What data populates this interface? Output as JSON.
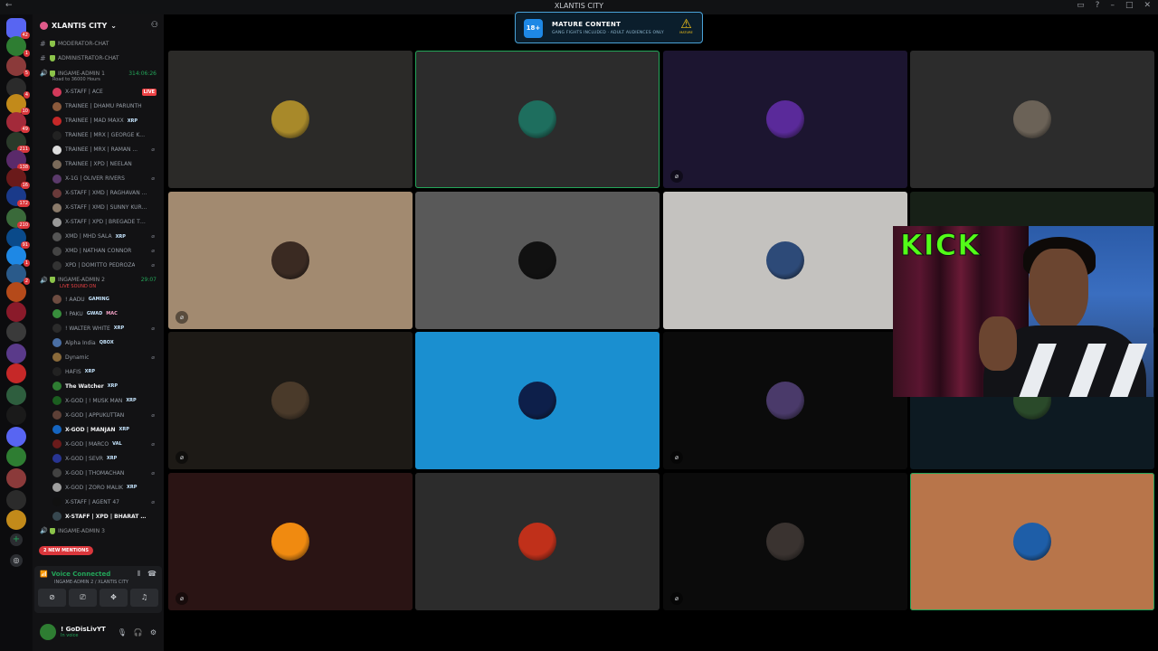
{
  "window": {
    "title": "XLANTIS CITY"
  },
  "server": {
    "name": "XLANTIS CITY"
  },
  "rail_badges": [
    "42",
    "1",
    "5",
    "4",
    "10",
    "49",
    "211",
    "138",
    "16",
    "172",
    "210",
    "91",
    "1",
    "2"
  ],
  "channels_top": [
    {
      "name": "MODERATOR-CHAT"
    },
    {
      "name": "ADMINISTRATOR-CHAT"
    }
  ],
  "voice_channel_1": {
    "name": "INGAME-ADMIN 1",
    "timer": "314:06:26",
    "status": "Road to 36000 Hours",
    "members": [
      {
        "name": "X-STAFF | ACE",
        "live": "LIVE",
        "color": "#d23a5a"
      },
      {
        "name": "TRAINEE | DHAMU PARUNTH",
        "color": "#8b5a3c"
      },
      {
        "name": "TRAINEE | MAD MAXX",
        "tag": "XRP",
        "color": "#c62828"
      },
      {
        "name": "TRAINEE | MRX | GEORGE KUT...",
        "color": "#222"
      },
      {
        "name": "TRAINEE | MRX | RAMAN ...",
        "mute": "mic-off-icon",
        "color": "#dddddd"
      },
      {
        "name": "TRAINEE | XPD | NEELAN",
        "color": "#7a6a5a"
      },
      {
        "name": "X-1G | OLIVER RIVERS",
        "mute": "mic-off-icon",
        "color": "#5b3a6b"
      },
      {
        "name": "X-STAFF | XMD | RAGHAVAN P...",
        "color": "#6a3a3a"
      },
      {
        "name": "X-STAFF | XMD | SUNNY KURU...",
        "color": "#8a7a6a"
      },
      {
        "name": "X-STAFF | XPD | BREGADE TO...",
        "color": "#9a9a9a"
      },
      {
        "name": "XMD | MHD SALA",
        "tag": "XRP",
        "mute": "mic-off-icon",
        "color": "#555"
      },
      {
        "name": "XMD | NATHAN CONNOR",
        "mute": "mic-off-icon",
        "color": "#444"
      },
      {
        "name": "XPD | DOMITTO PEDROZA",
        "mute": "mic-off-icon",
        "color": "#333"
      }
    ]
  },
  "voice_channel_2": {
    "name": "INGAME-ADMIN 2",
    "timer": "29:07",
    "status": "LIVE SOUND ON",
    "members": [
      {
        "name": "! AADU",
        "tag": "GAMING",
        "color": "#6d4c41"
      },
      {
        "name": "! PAKU",
        "tag": "GWAD",
        "tag2": "MAC",
        "color": "#388e3c"
      },
      {
        "name": "! WALTER WHITE",
        "tag": "XRP",
        "mute": "mic-off-icon",
        "color": "#2b2b2b"
      },
      {
        "name": "Alpha India",
        "tag": "QBOX",
        "color": "#4a6fa5"
      },
      {
        "name": "Dynamic",
        "mute": "mic-off-icon",
        "color": "#8a6a3a"
      },
      {
        "name": "HAFIS",
        "tag": "XRP",
        "color": "#222"
      },
      {
        "name": "The Watcher",
        "tag": "XRP",
        "bright": true,
        "color": "#2e7d32"
      },
      {
        "name": "X-GOD | ! MUSK MAN",
        "tag": "XRP",
        "color": "#1b5e20"
      },
      {
        "name": "X-GOD | APPUKUTTAN",
        "mute": "mic-off-icon",
        "color": "#5d4037"
      },
      {
        "name": "X-GOD | MANJAN",
        "tag": "XRP",
        "bright": true,
        "color": "#1565c0"
      },
      {
        "name": "X-GOD | MARCO",
        "tag": "VAL",
        "mute": "mic-off-icon",
        "color": "#6a1b1b"
      },
      {
        "name": "X-GOD | SEVR",
        "tag": "XRP",
        "color": "#283593"
      },
      {
        "name": "X-GOD | THOMACHAN",
        "mute": "mic-off-icon",
        "color": "#424242"
      },
      {
        "name": "X-GOD | ZORO MALIK",
        "tag": "XRP",
        "color": "#9e9e9e"
      },
      {
        "name": "X-STAFF | AGENT 47",
        "mute": "mic-off-icon",
        "color": "#111"
      },
      {
        "name": "X-STAFF | XPD | BHARAT CHA...",
        "bright": true,
        "color": "#37474f"
      }
    ]
  },
  "voice_channel_3": {
    "name": "INGAME-ADMIN 3"
  },
  "mentions_pill": "2 NEW MENTIONS",
  "voice_panel": {
    "title": "Voice Connected",
    "subtitle": "INGAME-ADMIN 2 / XLANTIS CITY"
  },
  "user": {
    "name": "! GoDisLivYT",
    "status": "In voice"
  },
  "mature_banner": {
    "age": "18+",
    "title": "MATURE CONTENT",
    "subtitle": "GANG FIGHTS INCLUDED · ADULT AUDIENCES ONLY",
    "badge": "MATURE"
  },
  "tiles": [
    {
      "bg": "#2b2a28",
      "avatar": "#a8892a",
      "muted": false,
      "speaking": false
    },
    {
      "bg": "#2c2c2c",
      "avatar": "#1e6e5e",
      "muted": false,
      "speaking": true
    },
    {
      "bg": "#1c1530",
      "avatar": "#5a2a9a",
      "muted": true,
      "speaking": false
    },
    {
      "bg": "#2c2c2c",
      "avatar": "#6b6257",
      "muted": false,
      "speaking": false
    },
    {
      "bg": "#a28a70",
      "avatar": "#3a2a22",
      "muted": true,
      "speaking": false
    },
    {
      "bg": "#595959",
      "avatar": "#111111",
      "muted": false,
      "speaking": false
    },
    {
      "bg": "#c4c2bf",
      "avatar": "#2d4a78",
      "muted": false,
      "speaking": false
    },
    {
      "bg": "#172017",
      "avatar": "#3a5a3a",
      "muted": false,
      "speaking": false
    },
    {
      "bg": "#1d1a16",
      "avatar": "#4a3a2a",
      "muted": true,
      "speaking": false
    },
    {
      "bg": "#1a8fd0",
      "avatar": "#0d1f4a",
      "muted": false,
      "speaking": false
    },
    {
      "bg": "#0b0b0b",
      "avatar": "#4a3a6a",
      "muted": true,
      "speaking": false
    },
    {
      "bg": "#0d1a22",
      "avatar": "#2a4a2a",
      "muted": false,
      "speaking": false
    },
    {
      "bg": "#2a1414",
      "avatar": "#f08a10",
      "muted": true,
      "speaking": false
    },
    {
      "bg": "#2c2c2c",
      "avatar": "#c0301a",
      "muted": false,
      "speaking": false
    },
    {
      "bg": "#0b0b0b",
      "avatar": "#3a3330",
      "muted": true,
      "speaking": false
    },
    {
      "bg": "#b8754a",
      "avatar": "#1e5ea8",
      "muted": false,
      "speaking": true
    }
  ],
  "webcam": {
    "overlay_text": "KICK"
  }
}
